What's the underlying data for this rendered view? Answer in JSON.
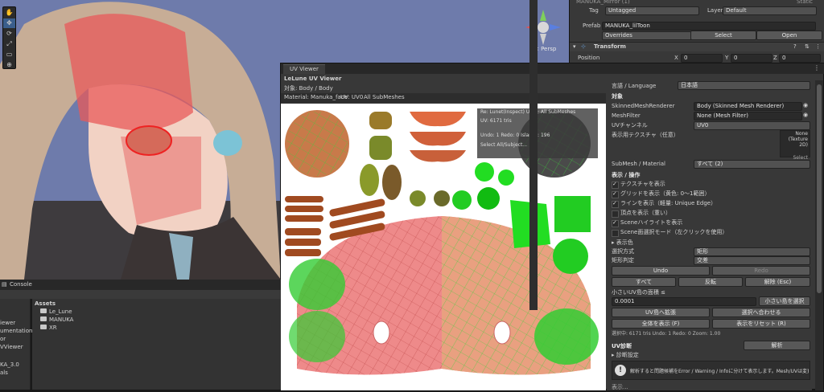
{
  "scene": {
    "tools": [
      "✋",
      "✥",
      "⟳",
      "⤢",
      "▭",
      "⊕"
    ],
    "persp_label": "< Persp"
  },
  "inspector": {
    "header_name": "MANUKA_Mirror (1)",
    "static_label": "Static",
    "tag_label": "Tag",
    "tag_value": "Untagged",
    "layer_label": "Layer",
    "layer_value": "Default",
    "prefab_label": "Prefab",
    "prefab_value": "MANUKA_lilToon",
    "overrides_label": "Overrides",
    "select_button": "Select",
    "open_button": "Open",
    "transform_title": "Transform",
    "position_label": "Position",
    "pos_x_label": "X",
    "pos_x": "0",
    "pos_y_label": "Y",
    "pos_y": "0",
    "pos_z_label": "Z",
    "pos_z": "0"
  },
  "uv_viewer": {
    "tab_title": "UV Viewer",
    "header_title": "LeLune UV Viewer",
    "target_label": "対象: Body / Body",
    "info_bar": [
      "Material: Manuka_face",
      "UV: UV0",
      "All SubMeshes"
    ],
    "overlay": {
      "line1": "Re: Lunet(Inspect) UV0 · All SubMeshes",
      "line2": "UV: 6171 tris",
      "line3": "Undo: 1   Redo: 0   Islands: 196",
      "line4": "Select All/Subject..."
    }
  },
  "panel": {
    "language_label": "言語 / Language",
    "language_value": "日本語",
    "target_section": "対象",
    "smr_label": "SkinnedMeshRenderer",
    "smr_value": "Body (Skinned Mesh Renderer)",
    "mf_label": "MeshFilter",
    "mf_value": "None (Mesh Filter)",
    "uv_channel_label": "UVチャンネル",
    "uv_channel_value": "UV0",
    "texture_label": "表示用テクスチャ（任意）",
    "texture_value_1": "None",
    "texture_value_2": "(Texture 2D)",
    "texture_select": "Select",
    "submesh_label": "SubMesh / Material",
    "submesh_value": "すべて (2)",
    "display_section": "表示 / 操作",
    "checks": [
      {
        "label": "テクスチャを表示",
        "on": true
      },
      {
        "label": "グリッドを表示（黄色: 0〜1範囲）",
        "on": true
      },
      {
        "label": "ラインを表示（軽量: Unique Edge）",
        "on": true
      },
      {
        "label": "頂点を表示（重い）",
        "on": false
      },
      {
        "label": "Sceneハイライトを表示",
        "on": true
      },
      {
        "label": "Scene面選択モード（左クリックを使用）",
        "on": false
      }
    ],
    "color_foldout": "▸ 表示色",
    "select_mode_label": "選択方式",
    "select_mode_value": "矩形",
    "rect_judge_label": "矩形判定",
    "rect_judge_value": "交差",
    "undo_button": "Undo",
    "redo_button": "Redo",
    "all_button": "すべて",
    "invert_button": "反転",
    "clear_button": "解除 (Esc)",
    "small_island_label": "小さいUV島の面積 ≤",
    "small_island_value": "0.0001",
    "small_island_button": "小さい島を選択",
    "expand_button": "UV島へ拡張",
    "fit_button": "選択へ合わせる",
    "show_all_button": "全体を表示 (F)",
    "reset_view_button": "表示をリセット (R)",
    "status_line": "選択中: 6171 tris  Undo: 1  Redo: 0  Zoom: 1.00",
    "uv_diag_label": "UV診断",
    "analyze_button": "解析",
    "diag_settings": "▸ 診断設定",
    "warning_text": "解析すると問題候補をError / Warning / Infoに分けて表示します。Mesh/UVは変更しません。",
    "bottom_cut": "表示..."
  },
  "bottom": {
    "console_label": "Console",
    "assets_label": "Assets",
    "folders": [
      "Le_Lune",
      "MANUKA",
      "XR"
    ],
    "left_items": [
      "iewer",
      "umentation",
      "or",
      "VViewer",
      "",
      "KA_3.0",
      "als"
    ]
  },
  "colors": {
    "accent_select": "#2c5d87",
    "uv_red": "#e86060",
    "uv_green": "#33dd33"
  }
}
